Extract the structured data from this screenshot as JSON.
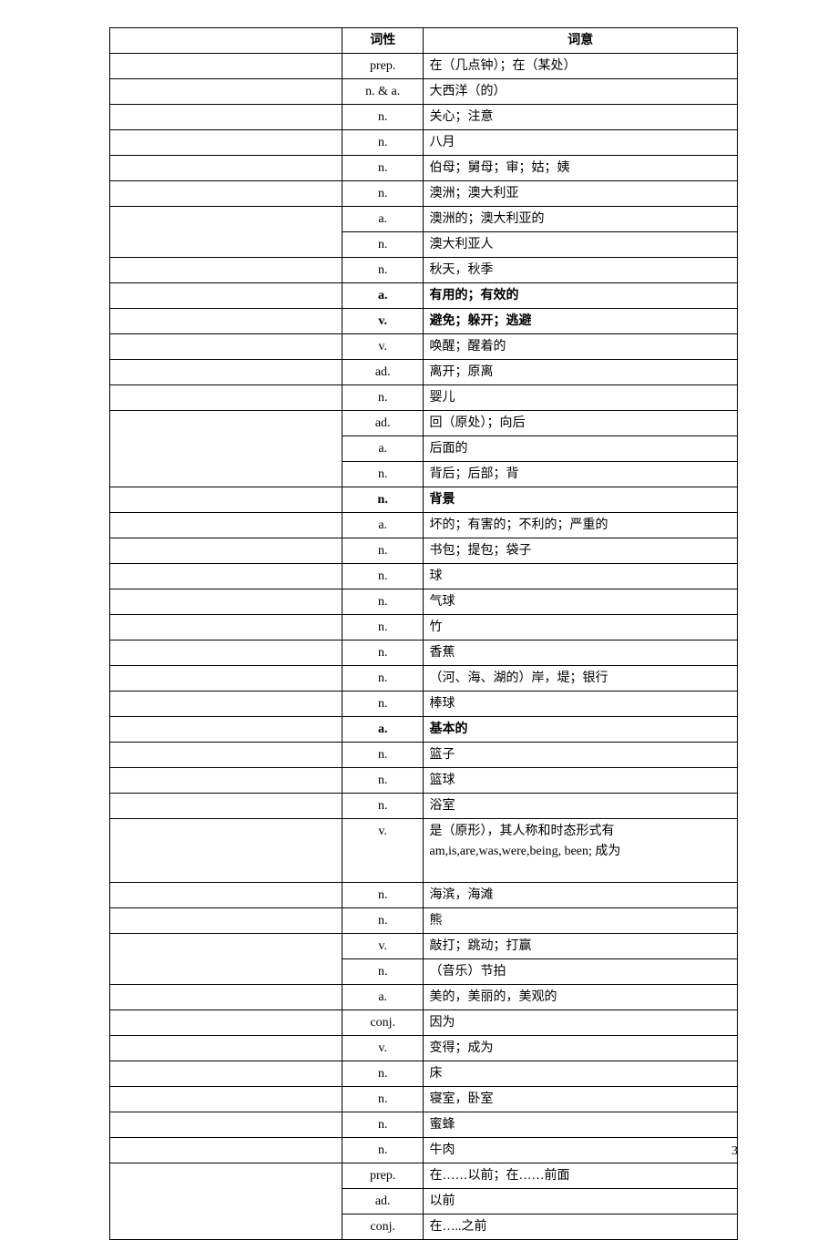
{
  "headers": {
    "word": "",
    "pos": "词性",
    "meaning": "词意"
  },
  "rows": [
    {
      "word": "",
      "pos": "prep.",
      "meaning": "在（几点钟）；在（某处）"
    },
    {
      "word": "",
      "pos": "n. & a.",
      "meaning": "大西洋（的）"
    },
    {
      "word": "",
      "pos": "n.",
      "meaning": "关心；注意"
    },
    {
      "word": "",
      "pos": "n.",
      "meaning": "八月"
    },
    {
      "word": "",
      "pos": "n.",
      "meaning": "伯母；舅母；审；姑；姨"
    },
    {
      "word": "",
      "pos": "n.",
      "meaning": "澳洲；澳大利亚"
    },
    {
      "word": "",
      "pos": "a.",
      "meaning": "澳洲的；澳大利亚的",
      "noBottomWord": true
    },
    {
      "word": "",
      "pos": "n.",
      "meaning": "澳大利亚人",
      "noTopWord": true
    },
    {
      "word": "",
      "pos": "n.",
      "meaning": "秋天，秋季"
    },
    {
      "word": "",
      "pos": "a.",
      "meaning": "有用的；有效的",
      "bold": true
    },
    {
      "word": "",
      "pos": "v.",
      "meaning": "避免；躲开；逃避",
      "bold": true
    },
    {
      "word": "",
      "pos": "v.",
      "meaning": "唤醒；醒着的"
    },
    {
      "word": "",
      "pos": "ad.",
      "meaning": "离开；原离"
    },
    {
      "word": "",
      "pos": "n.",
      "meaning": "婴儿"
    },
    {
      "word": "",
      "pos": "ad.",
      "meaning": "回（原处）；向后",
      "noBottomWord": true
    },
    {
      "word": "",
      "pos": "a.",
      "meaning": "后面的",
      "noTopWord": true,
      "noBottomWord": true
    },
    {
      "word": "",
      "pos": "n.",
      "meaning": "背后；后部；背",
      "noTopWord": true
    },
    {
      "word": "",
      "pos": "n.",
      "meaning": "背景",
      "bold": true
    },
    {
      "word": "",
      "pos": "a.",
      "meaning": "坏的；有害的；不利的；严重的"
    },
    {
      "word": "",
      "pos": "n.",
      "meaning": "书包；提包；袋子"
    },
    {
      "word": "",
      "pos": "n.",
      "meaning": "球"
    },
    {
      "word": "",
      "pos": "n.",
      "meaning": "气球"
    },
    {
      "word": "",
      "pos": "n.",
      "meaning": "竹"
    },
    {
      "word": "",
      "pos": "n.",
      "meaning": "香蕉"
    },
    {
      "word": "",
      "pos": "n.",
      "meaning": "（河、海、湖的）岸，堤；银行"
    },
    {
      "word": "",
      "pos": "n.",
      "meaning": "棒球"
    },
    {
      "word": "",
      "pos": "a.",
      "meaning": "基本的",
      "bold": true
    },
    {
      "word": "",
      "pos": "n.",
      "meaning": "篮子"
    },
    {
      "word": "",
      "pos": "n.",
      "meaning": "篮球"
    },
    {
      "word": "",
      "pos": "n.",
      "meaning": "浴室"
    },
    {
      "word": "",
      "pos": "v.",
      "meaning": "是（原形），其人称和时态形式有am,is,are,was,were,being, been; 成为",
      "tall": true
    },
    {
      "word": "",
      "pos": "n.",
      "meaning": "海滨，海滩"
    },
    {
      "word": "",
      "pos": "n.",
      "meaning": "熊"
    },
    {
      "word": "",
      "pos": "v.",
      "meaning": "敲打；跳动；打赢",
      "noBottomWord": true
    },
    {
      "word": "",
      "pos": "n.",
      "meaning": "（音乐）节拍",
      "noTopWord": true
    },
    {
      "word": "",
      "pos": "a.",
      "meaning": "美的，美丽的，美观的"
    },
    {
      "word": "",
      "pos": "conj.",
      "meaning": "因为"
    },
    {
      "word": "",
      "pos": "v.",
      "meaning": "变得；成为"
    },
    {
      "word": "",
      "pos": "n.",
      "meaning": "床"
    },
    {
      "word": "",
      "pos": "n.",
      "meaning": "寝室，卧室"
    },
    {
      "word": "",
      "pos": "n.",
      "meaning": "蜜蜂"
    },
    {
      "word": "",
      "pos": "n.",
      "meaning": "牛肉"
    },
    {
      "word": "",
      "pos": "prep.",
      "meaning": "在……以前；在……前面",
      "noBottomWord": true
    },
    {
      "word": "",
      "pos": "ad.",
      "meaning": "以前",
      "noTopWord": true,
      "noBottomWord": true
    },
    {
      "word": "",
      "pos": "conj.",
      "meaning": "在…..之前",
      "noTopWord": true
    }
  ],
  "pageNumber": "3"
}
